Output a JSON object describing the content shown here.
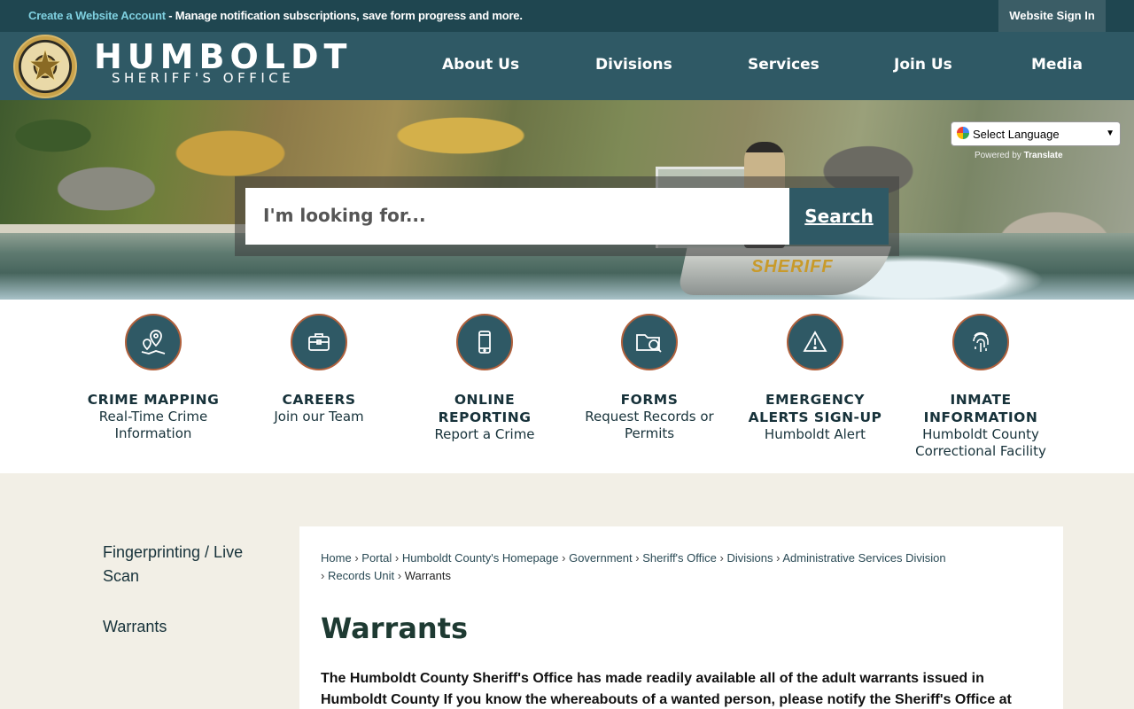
{
  "topbar": {
    "promo_link": "Create a Website Account",
    "promo_text": " - Manage notification subscriptions, save form progress and more.",
    "signin": "Website Sign In"
  },
  "header": {
    "brand_name": "HUMBOLDT",
    "brand_sub": "SHERIFF'S OFFICE",
    "nav": [
      "About Us",
      "Divisions",
      "Services",
      "Join Us",
      "Media"
    ]
  },
  "hero": {
    "hull_label": "SHERIFF",
    "language_select": "Select Language",
    "powered_by": "Powered by",
    "translate": "Translate",
    "search_placeholder": "I'm looking for...",
    "search_button": "Search"
  },
  "quick_links": [
    {
      "title": "CRIME MAPPING",
      "desc": "Real-Time Crime Information",
      "icon": "map-pin-icon"
    },
    {
      "title": "CAREERS",
      "desc": "Join our Team",
      "icon": "briefcase-icon"
    },
    {
      "title": "ONLINE REPORTING",
      "desc": "Report a Crime",
      "icon": "mobile-phone-icon"
    },
    {
      "title": "FORMS",
      "desc": "Request Records or Permits",
      "icon": "folder-search-icon"
    },
    {
      "title": "EMERGENCY ALERTS SIGN-UP",
      "desc": "Humboldt Alert",
      "icon": "warning-icon"
    },
    {
      "title": "INMATE INFORMATION",
      "desc": "Humboldt County Correctional Facility",
      "icon": "fingerprint-icon"
    }
  ],
  "sidenav": [
    "Fingerprinting / Live Scan",
    "Warrants"
  ],
  "breadcrumb": {
    "items": [
      "Home",
      "Portal",
      "Humboldt County's Homepage",
      "Government",
      "Sheriff's Office",
      "Divisions",
      "Administrative Services Division",
      "Records Unit"
    ],
    "current": "Warrants"
  },
  "page": {
    "title": "Warrants",
    "intro": "The Humboldt County Sheriff's Office has made readily available all of the adult warrants issued in Humboldt County If you know the whereabouts of a wanted person, please notify the Sheriff's Office at"
  },
  "colors": {
    "header": "#2f5965",
    "topbar": "#1f4650",
    "accent_border": "#b0603c",
    "content_bg": "#f2efe6"
  }
}
